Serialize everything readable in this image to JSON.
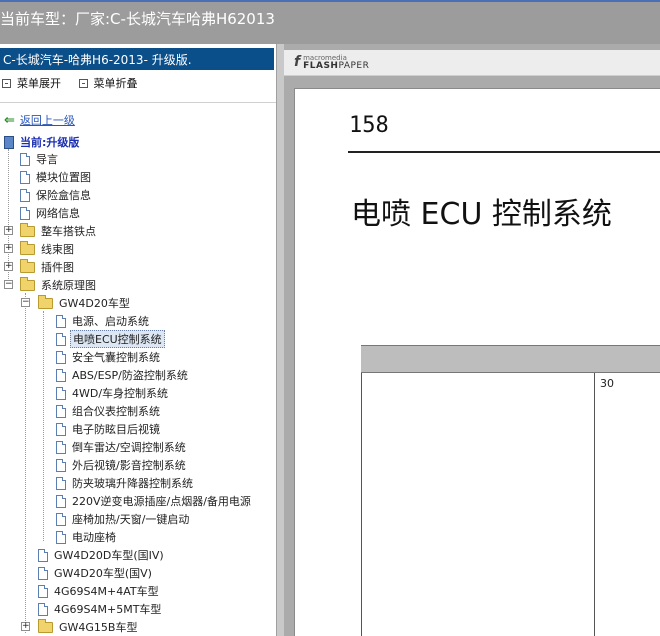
{
  "window": {
    "title": "当前车型：厂家:C-长城汽车哈弗H62013"
  },
  "left_panel": {
    "header": "C-长城汽车-哈弗H6-2013- 升级版.",
    "expand_label": "菜单展开",
    "collapse_label": "菜单折叠",
    "back_label": "返回上一级",
    "current_label": "当前:升级版"
  },
  "tree": {
    "top_items": [
      "导言",
      "模块位置图",
      "保险盒信息",
      "网络信息"
    ],
    "folders": [
      "整车搭铁点",
      "线束图",
      "插件图",
      "系统原理图"
    ],
    "subfolder": "GW4D20车型",
    "systems": [
      "电源、启动系统",
      "电喷ECU控制系统",
      "安全气囊控制系统",
      "ABS/ESP/防盗控制系统",
      "4WD/车身控制系统",
      "组合仪表控制系统",
      "电子防眩目后视镜",
      "倒车雷达/空调控制系统",
      "外后视镜/影音控制系统",
      "防夹玻璃升降器控制系统",
      "220V逆变电源插座/点烟器/备用电源",
      "座椅加热/天窗/一键启动",
      "电动座椅"
    ],
    "models": [
      "GW4D20D车型(国IV)",
      "GW4D20车型(国V)",
      "4G69S4M+4AT车型",
      "4G69S4M+5MT车型"
    ],
    "last_folder": "GW4G15B车型"
  },
  "viewer": {
    "logo_small": "macromedia",
    "logo_brand_bold": "FLASH",
    "logo_brand": "PAPER",
    "page_number": "158",
    "doc_title": "电喷 ECU 控制系统",
    "table_cell_number": "30"
  },
  "colors": {
    "header_blue": "#0b4f8a",
    "titlebar_gray": "#9c9c9c",
    "current_blue": "#1b2fb0",
    "link_blue": "#2a55b8"
  }
}
